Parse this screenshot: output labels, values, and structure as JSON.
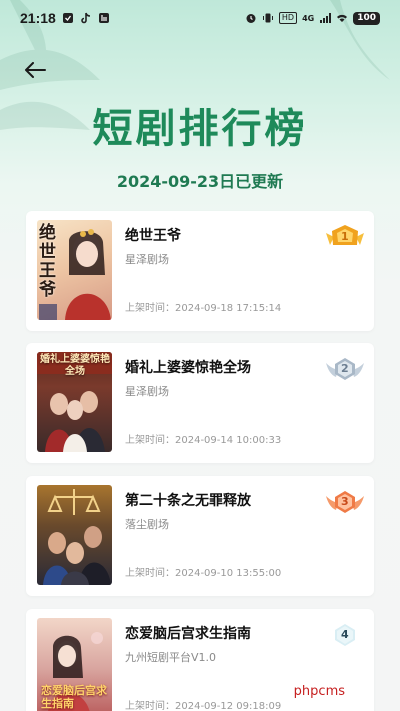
{
  "status_bar": {
    "time": "21:18",
    "hd_label": "HD",
    "net_label": "4G",
    "battery": "100"
  },
  "header": {
    "title": "短剧排行榜",
    "update_date": "2024-09-23日已更新"
  },
  "colors": {
    "brand_green": "#1e8a5a",
    "gold": "#f0a21e",
    "silver": "#a9b8c7",
    "bronze": "#ef7a46"
  },
  "list": [
    {
      "rank": "1",
      "title": "绝世王爷",
      "producer": "星泽剧场",
      "date": "上架时间：2024-09-18 17:15:14",
      "cover_text": "绝世王爷",
      "badge": "gold"
    },
    {
      "rank": "2",
      "title": "婚礼上婆婆惊艳全场",
      "producer": "星泽剧场",
      "date": "上架时间：2024-09-14 10:00:33",
      "cover_text": "婚礼上婆婆惊艳全场",
      "badge": "silver"
    },
    {
      "rank": "3",
      "title": "第二十条之无罪释放",
      "producer": "落尘剧场",
      "date": "上架时间：2024-09-10 13:55:00",
      "cover_text": "",
      "badge": "bronze"
    },
    {
      "rank": "4",
      "title": "恋爱脑后宫求生指南",
      "producer": "九州短剧平台V1.0",
      "date": "上架时间：2024-09-12 09:18:09",
      "cover_text": "恋爱脑后宫求生指南",
      "badge": "plain"
    }
  ],
  "watermark": "phpcms"
}
